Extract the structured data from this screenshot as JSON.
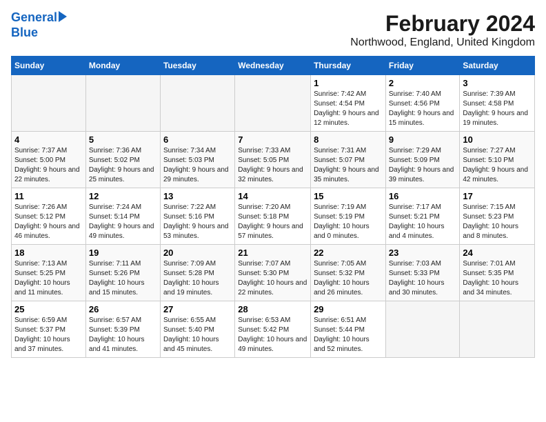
{
  "header": {
    "logo_line1": "General",
    "logo_line2": "Blue",
    "title": "February 2024",
    "subtitle": "Northwood, England, United Kingdom"
  },
  "weekdays": [
    "Sunday",
    "Monday",
    "Tuesday",
    "Wednesday",
    "Thursday",
    "Friday",
    "Saturday"
  ],
  "weeks": [
    [
      {
        "day": "",
        "info": ""
      },
      {
        "day": "",
        "info": ""
      },
      {
        "day": "",
        "info": ""
      },
      {
        "day": "",
        "info": ""
      },
      {
        "day": "1",
        "info": "Sunrise: 7:42 AM\nSunset: 4:54 PM\nDaylight: 9 hours\nand 12 minutes."
      },
      {
        "day": "2",
        "info": "Sunrise: 7:40 AM\nSunset: 4:56 PM\nDaylight: 9 hours\nand 15 minutes."
      },
      {
        "day": "3",
        "info": "Sunrise: 7:39 AM\nSunset: 4:58 PM\nDaylight: 9 hours\nand 19 minutes."
      }
    ],
    [
      {
        "day": "4",
        "info": "Sunrise: 7:37 AM\nSunset: 5:00 PM\nDaylight: 9 hours\nand 22 minutes."
      },
      {
        "day": "5",
        "info": "Sunrise: 7:36 AM\nSunset: 5:02 PM\nDaylight: 9 hours\nand 25 minutes."
      },
      {
        "day": "6",
        "info": "Sunrise: 7:34 AM\nSunset: 5:03 PM\nDaylight: 9 hours\nand 29 minutes."
      },
      {
        "day": "7",
        "info": "Sunrise: 7:33 AM\nSunset: 5:05 PM\nDaylight: 9 hours\nand 32 minutes."
      },
      {
        "day": "8",
        "info": "Sunrise: 7:31 AM\nSunset: 5:07 PM\nDaylight: 9 hours\nand 35 minutes."
      },
      {
        "day": "9",
        "info": "Sunrise: 7:29 AM\nSunset: 5:09 PM\nDaylight: 9 hours\nand 39 minutes."
      },
      {
        "day": "10",
        "info": "Sunrise: 7:27 AM\nSunset: 5:10 PM\nDaylight: 9 hours\nand 42 minutes."
      }
    ],
    [
      {
        "day": "11",
        "info": "Sunrise: 7:26 AM\nSunset: 5:12 PM\nDaylight: 9 hours\nand 46 minutes."
      },
      {
        "day": "12",
        "info": "Sunrise: 7:24 AM\nSunset: 5:14 PM\nDaylight: 9 hours\nand 49 minutes."
      },
      {
        "day": "13",
        "info": "Sunrise: 7:22 AM\nSunset: 5:16 PM\nDaylight: 9 hours\nand 53 minutes."
      },
      {
        "day": "14",
        "info": "Sunrise: 7:20 AM\nSunset: 5:18 PM\nDaylight: 9 hours\nand 57 minutes."
      },
      {
        "day": "15",
        "info": "Sunrise: 7:19 AM\nSunset: 5:19 PM\nDaylight: 10 hours\nand 0 minutes."
      },
      {
        "day": "16",
        "info": "Sunrise: 7:17 AM\nSunset: 5:21 PM\nDaylight: 10 hours\nand 4 minutes."
      },
      {
        "day": "17",
        "info": "Sunrise: 7:15 AM\nSunset: 5:23 PM\nDaylight: 10 hours\nand 8 minutes."
      }
    ],
    [
      {
        "day": "18",
        "info": "Sunrise: 7:13 AM\nSunset: 5:25 PM\nDaylight: 10 hours\nand 11 minutes."
      },
      {
        "day": "19",
        "info": "Sunrise: 7:11 AM\nSunset: 5:26 PM\nDaylight: 10 hours\nand 15 minutes."
      },
      {
        "day": "20",
        "info": "Sunrise: 7:09 AM\nSunset: 5:28 PM\nDaylight: 10 hours\nand 19 minutes."
      },
      {
        "day": "21",
        "info": "Sunrise: 7:07 AM\nSunset: 5:30 PM\nDaylight: 10 hours\nand 22 minutes."
      },
      {
        "day": "22",
        "info": "Sunrise: 7:05 AM\nSunset: 5:32 PM\nDaylight: 10 hours\nand 26 minutes."
      },
      {
        "day": "23",
        "info": "Sunrise: 7:03 AM\nSunset: 5:33 PM\nDaylight: 10 hours\nand 30 minutes."
      },
      {
        "day": "24",
        "info": "Sunrise: 7:01 AM\nSunset: 5:35 PM\nDaylight: 10 hours\nand 34 minutes."
      }
    ],
    [
      {
        "day": "25",
        "info": "Sunrise: 6:59 AM\nSunset: 5:37 PM\nDaylight: 10 hours\nand 37 minutes."
      },
      {
        "day": "26",
        "info": "Sunrise: 6:57 AM\nSunset: 5:39 PM\nDaylight: 10 hours\nand 41 minutes."
      },
      {
        "day": "27",
        "info": "Sunrise: 6:55 AM\nSunset: 5:40 PM\nDaylight: 10 hours\nand 45 minutes."
      },
      {
        "day": "28",
        "info": "Sunrise: 6:53 AM\nSunset: 5:42 PM\nDaylight: 10 hours\nand 49 minutes."
      },
      {
        "day": "29",
        "info": "Sunrise: 6:51 AM\nSunset: 5:44 PM\nDaylight: 10 hours\nand 52 minutes."
      },
      {
        "day": "",
        "info": ""
      },
      {
        "day": "",
        "info": ""
      }
    ]
  ]
}
